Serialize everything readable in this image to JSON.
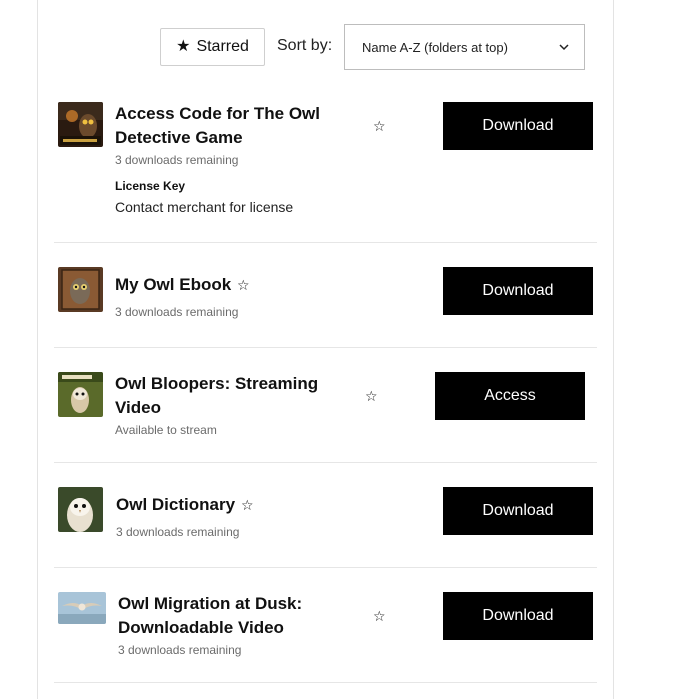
{
  "toolbar": {
    "starred_label": "Starred",
    "sort_label": "Sort by:",
    "sort_value": "Name A-Z (folders at top)"
  },
  "items": [
    {
      "title_line1": "Access Code for The Owl",
      "title_line2": "Detective Game",
      "status": "3 downloads remaining",
      "license_label": "License Key",
      "license_value": "Contact merchant for license",
      "action": "Download",
      "thumb_icon": "owl-detective-game-thumbnail"
    },
    {
      "title": "My Owl Ebook",
      "status": "3 downloads remaining",
      "action": "Download",
      "thumb_icon": "owl-ebook-thumbnail"
    },
    {
      "title_line1": "Owl Bloopers: Streaming",
      "title_line2": "Video",
      "status": "Available to stream",
      "action": "Access",
      "thumb_icon": "owl-bloopers-thumbnail"
    },
    {
      "title": "Owl Dictionary",
      "status": "3 downloads remaining",
      "action": "Download",
      "thumb_icon": "owl-dictionary-thumbnail"
    },
    {
      "title_line1": "Owl Migration at Dusk:",
      "title_line2": "Downloadable Video",
      "status": "3 downloads remaining",
      "action": "Download",
      "thumb_icon": "owl-migration-thumbnail"
    }
  ],
  "colors": {
    "button_bg": "#000000",
    "button_text": "#ffffff",
    "muted_text": "#6b6b6b",
    "divider": "#e6e6e6"
  }
}
